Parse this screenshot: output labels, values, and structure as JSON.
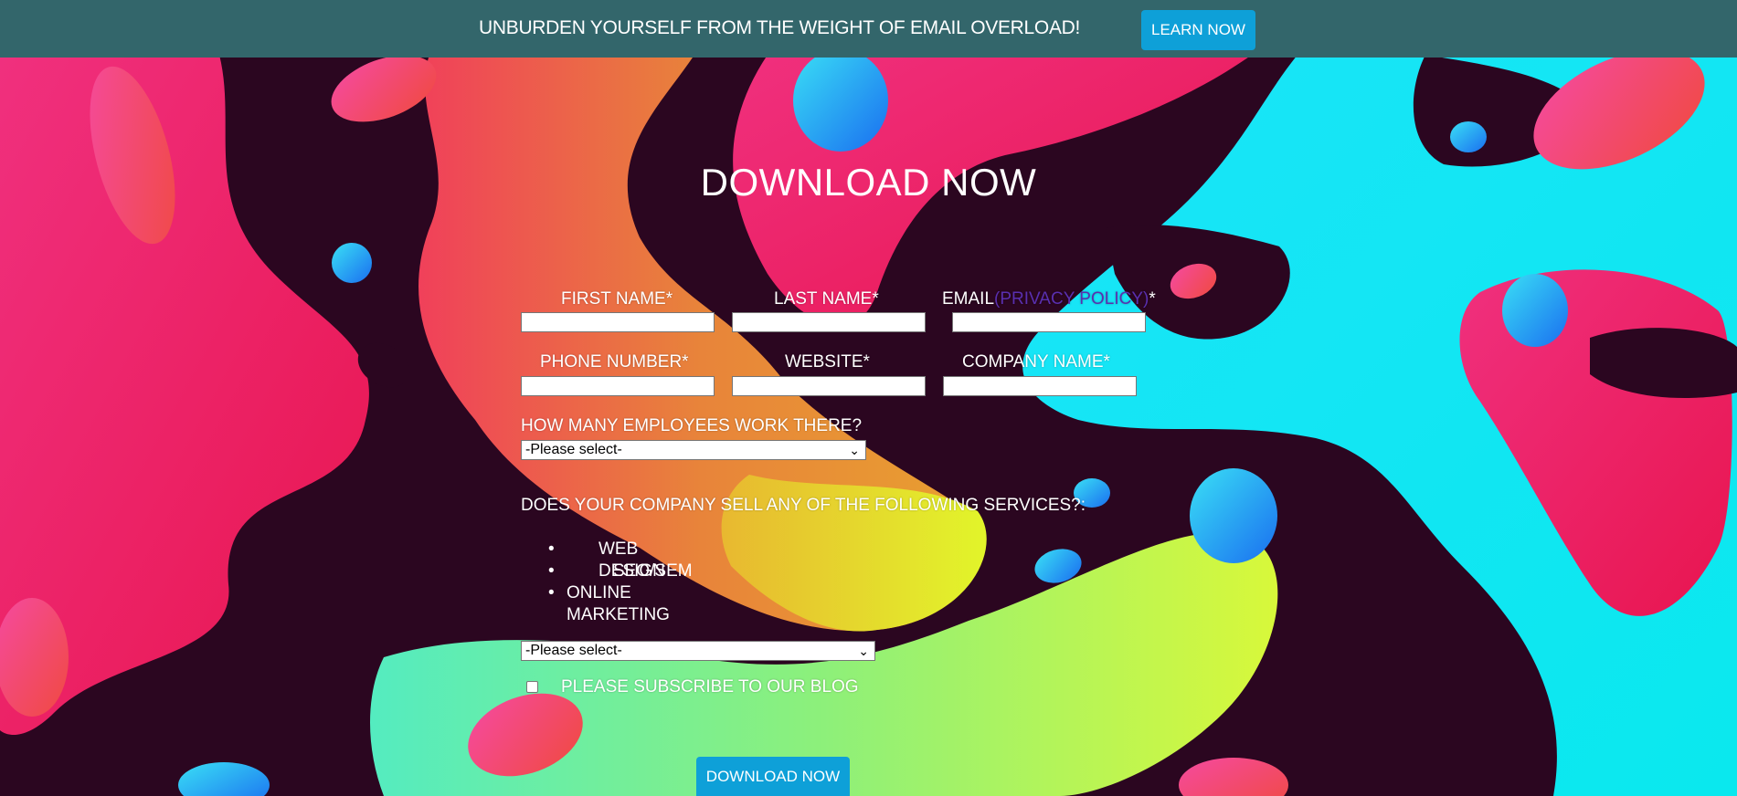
{
  "banner": {
    "text": "UNBURDEN YOURSELF FROM THE WEIGHT OF EMAIL OVERLOAD!",
    "button_label": "LEARN NOW"
  },
  "form": {
    "title": "DOWNLOAD NOW",
    "fields": {
      "first_name": "FIRST NAME*",
      "last_name": "LAST NAME*",
      "email": "EMAIL",
      "privacy_policy": "(PRIVACY POLICY)",
      "email_required": "*",
      "phone": "PHONE NUMBER*",
      "website": "WEBSITE*",
      "company": "COMPANY NAME*"
    },
    "employees_question": "HOW MANY EMPLOYEES WORK THERE?",
    "employees_select": "-Please select-",
    "services_question": "DOES YOUR COMPANY SELL ANY OF THE FOLLOWING SERVICES?:",
    "services": [
      "WEB DESIGN",
      "SEO/SEM",
      "ONLINE MARKETING"
    ],
    "services_select": "-Please select-",
    "subscribe_label": "PLEASE SUBSCRIBE TO OUR BLOG",
    "submit_label": "DOWNLOAD NOW"
  },
  "colors": {
    "banner_bg": "#33666b",
    "button_bg": "#0ea0d8",
    "privacy_link": "#5a2fb0"
  }
}
